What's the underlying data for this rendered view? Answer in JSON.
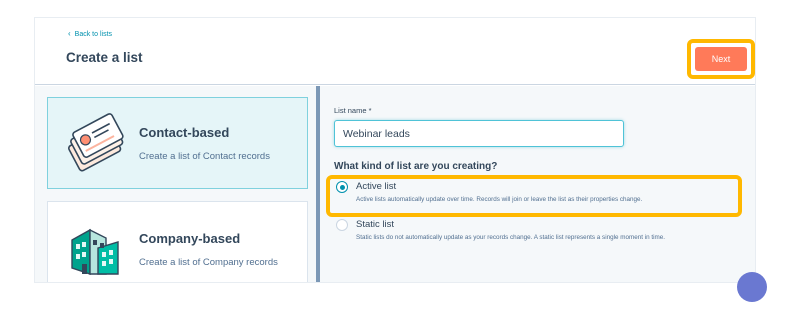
{
  "header": {
    "back_label": "Back to lists",
    "title": "Create a list",
    "next_label": "Next"
  },
  "cards": {
    "contact": {
      "title": "Contact-based",
      "description": "Create a list of Contact records",
      "selected": true
    },
    "company": {
      "title": "Company-based",
      "description": "Create a list of Company records",
      "selected": false
    }
  },
  "form": {
    "name_label": "List name *",
    "name_value": "Webinar leads",
    "question": "What kind of list are you creating?",
    "options": [
      {
        "label": "Active list",
        "description": "Active lists automatically update over time. Records will join or leave the list as their properties change.",
        "selected": true
      },
      {
        "label": "Static list",
        "description": "Static lists do not automatically update as your records change. A static list represents a single moment in time.",
        "selected": false
      }
    ]
  },
  "colors": {
    "accent": "#ff7a59",
    "highlight": "#ffb800",
    "link": "#0091ae",
    "selected_card_bg": "#e5f5f8"
  },
  "icons": {
    "contact": "contact-cards-icon",
    "company": "buildings-icon",
    "back": "chevron-left-icon",
    "help": "help-bubble-icon"
  }
}
